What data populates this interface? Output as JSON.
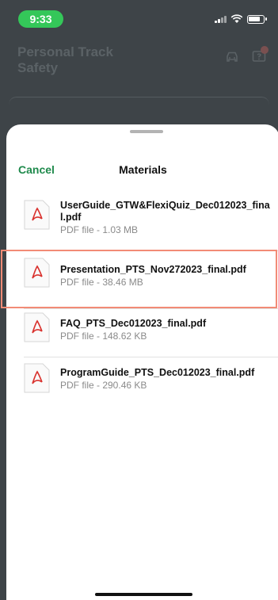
{
  "status_bar": {
    "time": "9:33"
  },
  "app_header": {
    "title": "Personal Track Safety"
  },
  "sheet": {
    "cancel_label": "Cancel",
    "title": "Materials",
    "files": [
      {
        "name": "UserGuide_GTW&FlexiQuiz_Dec012023_final.pdf",
        "info": "PDF file - 1.03 MB"
      },
      {
        "name": "Presentation_PTS_Nov272023_final.pdf",
        "info": "PDF file - 38.46 MB"
      },
      {
        "name": "FAQ_PTS_Dec012023_final.pdf",
        "info": "PDF file - 148.62 KB"
      },
      {
        "name": "ProgramGuide_PTS_Dec012023_final.pdf",
        "info": "PDF file - 290.46 KB"
      }
    ]
  },
  "colors": {
    "accent_green": "#1f8a4c",
    "time_pill": "#34c759",
    "highlight_border": "#f28b76",
    "pdf_red": "#d9322e"
  }
}
